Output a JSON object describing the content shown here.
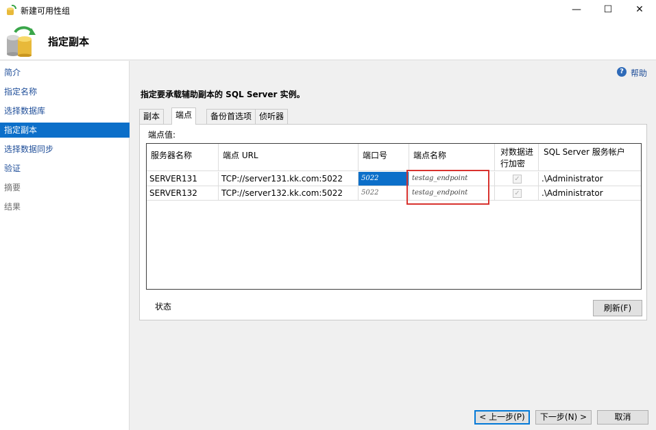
{
  "window": {
    "title": "新建可用性组",
    "minimize": "—",
    "maximize": "☐",
    "close": "✕"
  },
  "header": {
    "title": "指定副本"
  },
  "sidebar": {
    "items": [
      {
        "label": "简介",
        "state": "normal"
      },
      {
        "label": "指定名称",
        "state": "normal"
      },
      {
        "label": "选择数据库",
        "state": "normal"
      },
      {
        "label": "指定副本",
        "state": "selected"
      },
      {
        "label": "选择数据同步",
        "state": "normal"
      },
      {
        "label": "验证",
        "state": "normal"
      },
      {
        "label": "摘要",
        "state": "disabled"
      },
      {
        "label": "结果",
        "state": "disabled"
      }
    ]
  },
  "help": {
    "label": "帮助",
    "icon": "help-icon"
  },
  "instruction": "指定要承载辅助副本的 SQL Server 实例。",
  "tabs": [
    {
      "label": "副本",
      "active": false
    },
    {
      "label": "端点",
      "active": true
    },
    {
      "label": "备份首选项",
      "active": false
    },
    {
      "label": "侦听器",
      "active": false
    }
  ],
  "endpoint_panel": {
    "label": "端点值:",
    "columns": {
      "server": "服务器名称",
      "url": "端点 URL",
      "port": "端口号",
      "name": "端点名称",
      "encrypt": "对数据进行加密",
      "account": "SQL Server 服务帐户"
    },
    "rows": [
      {
        "server": "SERVER131",
        "url": "TCP://server131.kk.com:5022",
        "port": "5022",
        "name": "testag_endpoint",
        "encrypt": "✓",
        "account": ".\\Administrator"
      },
      {
        "server": "SERVER132",
        "url": "TCP://server132.kk.com:5022",
        "port": "5022",
        "name": "testag_endpoint",
        "encrypt": "✓",
        "account": ".\\Administrator"
      }
    ],
    "status_label": "状态",
    "refresh_label": "刷新(F)"
  },
  "footer": {
    "prev": "< 上一步(P)",
    "next": "下一步(N) >",
    "cancel": "取消"
  },
  "colors": {
    "selection": "#0c6fc9",
    "highlight_box": "#d8312d",
    "link": "#1f4e99"
  }
}
